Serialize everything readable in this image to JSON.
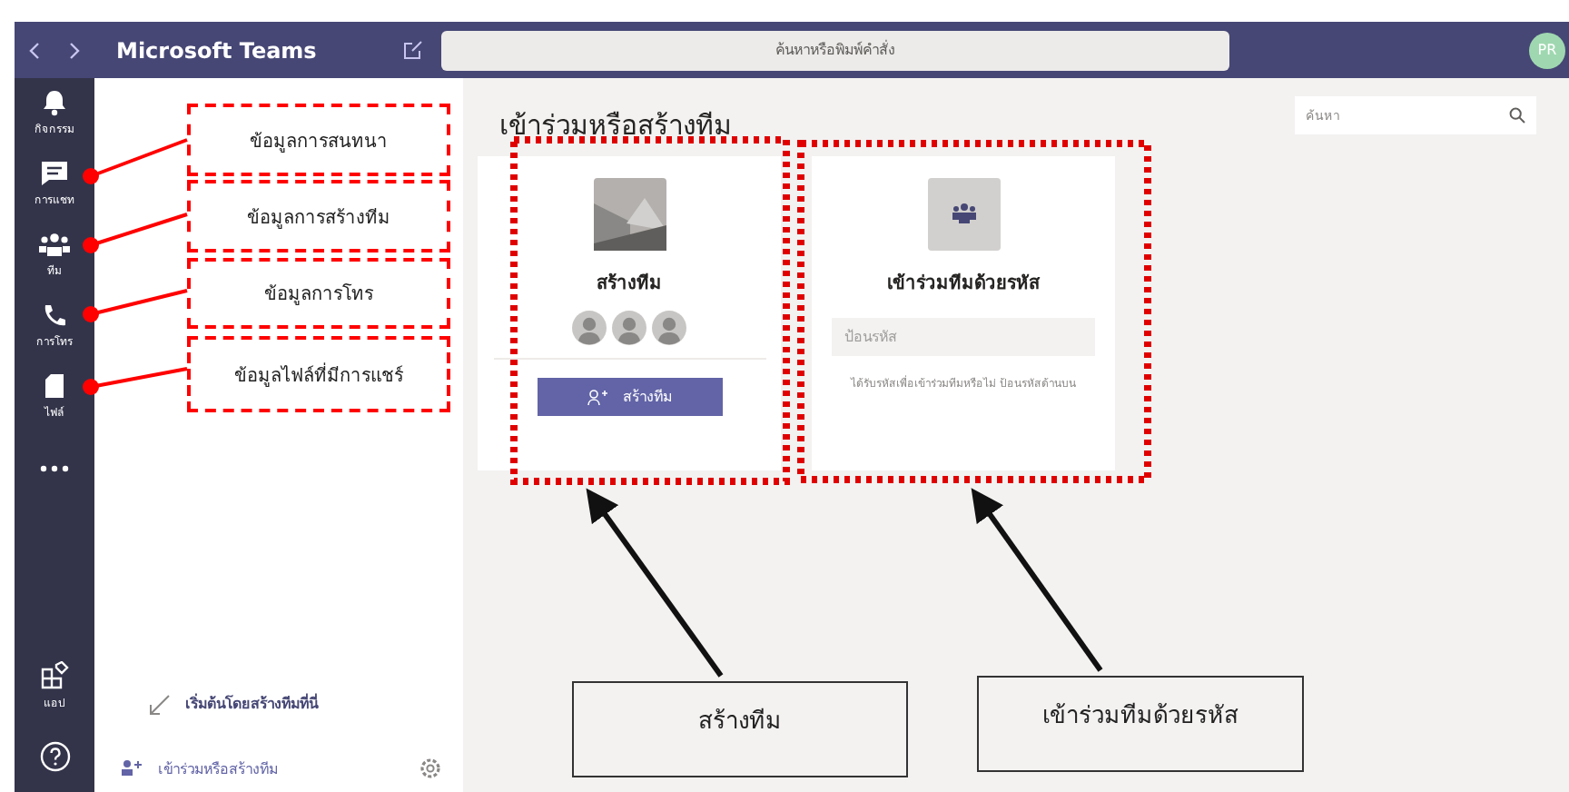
{
  "window": {
    "title": "Microsoft Teams"
  },
  "search": {
    "placeholder": "ค้นหาหรือพิมพ์คำสั่ง"
  },
  "avatar": {
    "initials": "PR"
  },
  "rail": [
    {
      "label": "กิจกรรม",
      "kind": "bell"
    },
    {
      "label": "การแชท",
      "kind": "chat"
    },
    {
      "label": "ทีม",
      "kind": "teams"
    },
    {
      "label": "การโทร",
      "kind": "phone"
    },
    {
      "label": "ไฟล์",
      "kind": "file"
    },
    {
      "kind": "more"
    }
  ],
  "rail_bottom": [
    {
      "label": "แอป",
      "kind": "apps"
    },
    {
      "kind": "help"
    }
  ],
  "sidebar": {
    "hint": "เริ่มต้นโดยสร้างทีมที่นี่",
    "join_create": "เข้าร่วมหรือสร้างทีม"
  },
  "main": {
    "title": "เข้าร่วมหรือสร้างทีม",
    "search_placeholder": "ค้นหา",
    "cards": [
      {
        "kind": "create",
        "title": "สร้างทีม",
        "button": "สร้างทีม"
      },
      {
        "kind": "join",
        "title": "เข้าร่วมทีมด้วยรหัส",
        "placeholder": "ป้อนรหัส",
        "note": "ได้รับรหัสเพื่อเข้าร่วมทีมหรือไม่ ป้อนรหัสด้านบน"
      }
    ]
  },
  "annotations": {
    "callouts": [
      "ข้อมูลการสนทนา",
      "ข้อมูลการสร้างทีม",
      "ข้อมูลการโทร",
      "ข้อมูลไฟล์ที่มีการแชร์"
    ],
    "labels": [
      "สร้างทีม",
      "เข้าร่วมทีมด้วยรหัส"
    ]
  }
}
